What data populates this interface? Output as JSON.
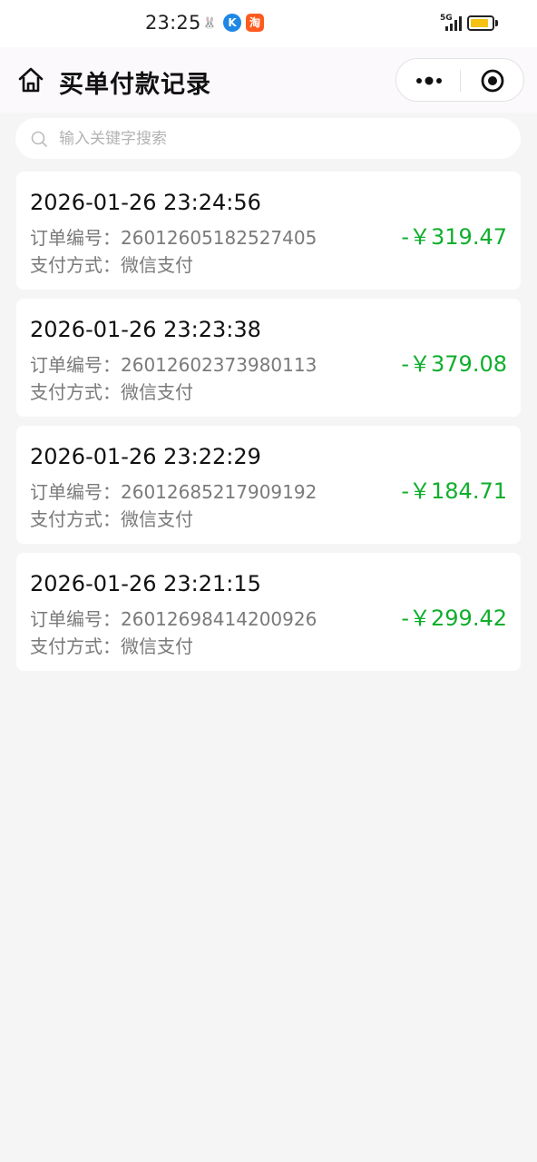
{
  "status_bar": {
    "time": "23:25",
    "network": "5G",
    "colors": {
      "battery": "#f5c211",
      "app2": "#1e88e5",
      "app3": "#ff5a1f"
    },
    "app_icons": [
      "yellow-rabbit-icon",
      "k-app-icon",
      "taobao-icon"
    ],
    "app_icon_glyphs": [
      "🐰",
      "K",
      "淘"
    ]
  },
  "nav": {
    "title": "买单付款记录",
    "home_icon": "home-icon",
    "more_icon": "more-dots-icon",
    "close_icon": "target-close-icon"
  },
  "search": {
    "placeholder": "输入关键字搜索",
    "value": ""
  },
  "records": [
    {
      "time": "2026-01-26 23:24:56",
      "order_label": "订单编号：",
      "order_no": "26012605182527405",
      "pay_label": "支付方式：",
      "pay_method": "微信支付",
      "amount": "-￥319.47"
    },
    {
      "time": "2026-01-26 23:23:38",
      "order_label": "订单编号：",
      "order_no": "26012602373980113",
      "pay_label": "支付方式：",
      "pay_method": "微信支付",
      "amount": "-￥379.08"
    },
    {
      "time": "2026-01-26 23:22:29",
      "order_label": "订单编号：",
      "order_no": "26012685217909192",
      "pay_label": "支付方式：",
      "pay_method": "微信支付",
      "amount": "-￥184.71"
    },
    {
      "time": "2026-01-26 23:21:15",
      "order_label": "订单编号：",
      "order_no": "26012698414200926",
      "pay_label": "支付方式：",
      "pay_method": "微信支付",
      "amount": "-￥299.42"
    }
  ],
  "colors": {
    "amount": "#0fae2c",
    "background": "#f5f5f5",
    "card": "#ffffff"
  }
}
